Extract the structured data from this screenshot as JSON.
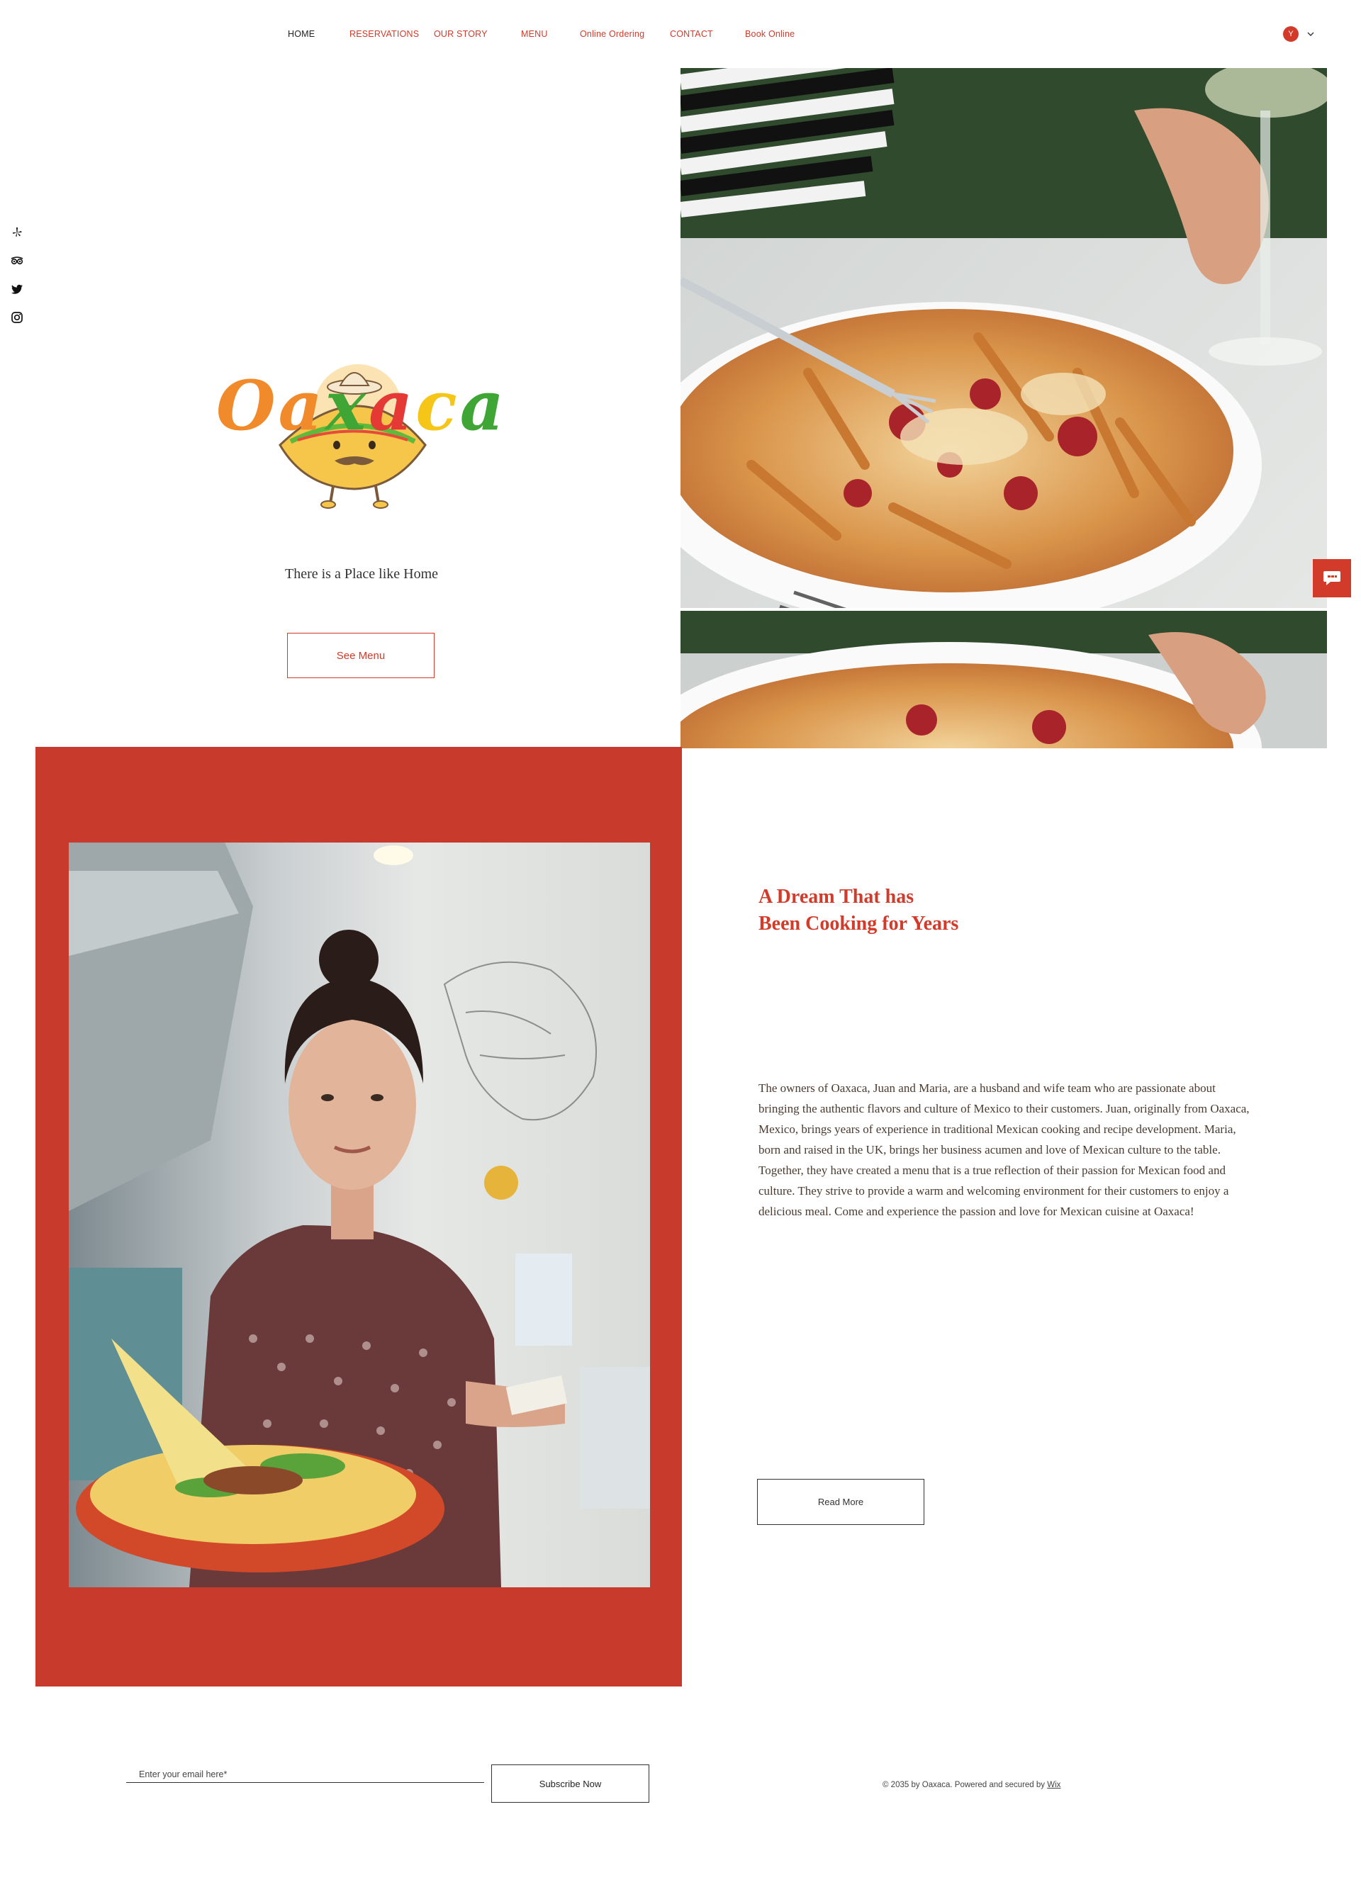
{
  "nav": {
    "items": [
      {
        "label": "HOME",
        "active": true
      },
      {
        "label": "RESERVATIONS"
      },
      {
        "label": "OUR STORY"
      },
      {
        "label": "MENU"
      },
      {
        "label": "Online Ordering"
      },
      {
        "label": "CONTACT"
      },
      {
        "label": "Book Online"
      }
    ]
  },
  "account": {
    "initial": "Y"
  },
  "social": [
    "yelp-icon",
    "tripadvisor-icon",
    "twitter-icon",
    "instagram-icon"
  ],
  "hero": {
    "brand": "Oaxaca",
    "tagline": "There is a Place like Home",
    "button": "See Menu"
  },
  "story": {
    "title_line1": "A Dream That has",
    "title_line2": "Been Cooking for Years",
    "body": "The owners of Oaxaca, Juan and Maria, are a husband and wife team who are passionate about bringing the authentic flavors and culture of Mexico to their customers. Juan, originally from Oaxaca, Mexico, brings years of experience in traditional Mexican cooking and recipe development. Maria, born and raised in the UK, brings her business acumen and love of Mexican culture to the table. Together, they have created a menu that is a true reflection of their passion for Mexican food and culture. They strive to provide a warm and welcoming environment for their customers to enjoy a delicious meal. Come and experience the passion and love for Mexican cuisine at Oaxaca!",
    "button": "Read More"
  },
  "footer": {
    "email_placeholder": "Enter your email here*",
    "subscribe": "Subscribe Now",
    "copyright": "© 2035 by Oaxaca. Powered and secured by ",
    "wix": "Wix"
  },
  "colors": {
    "accent": "#d23a2a",
    "panel": "#c83a2b",
    "logo_orange": "#f08a2a",
    "logo_green": "#3fa535",
    "logo_red": "#e53935",
    "logo_yellow": "#f5c518"
  }
}
